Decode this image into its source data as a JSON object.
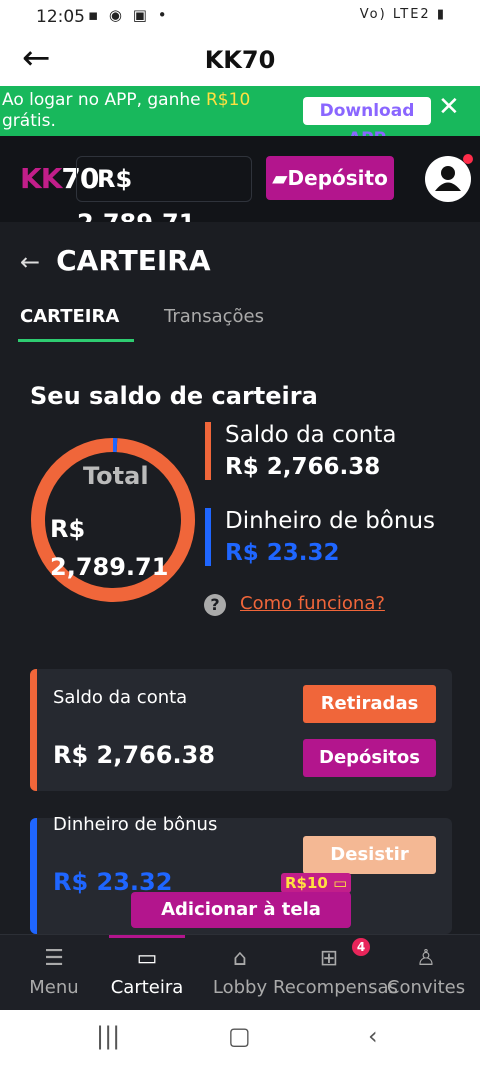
{
  "status_bar": {
    "time": "12:05",
    "left_icons": "▪ ◉ ▣ •",
    "right_icons": "Vo) LTE2 ▮"
  },
  "app_header": {
    "title": "KK70"
  },
  "promo": {
    "text_before": "Ao logar no APP, ganhe ",
    "amount": "R$10",
    "text_after": " grátis.",
    "download_label": "Download APP"
  },
  "site_header": {
    "logo_kk": "KK",
    "logo_num": "70",
    "balance": "R$ 2,789.71",
    "deposit_label": "Depósito"
  },
  "page": {
    "title": "CARTEIRA",
    "tabs": [
      "CARTEIRA",
      "Transações"
    ],
    "section_title": "Seu saldo de carteira"
  },
  "donut": {
    "total_label": "Total",
    "total_value_line1": "R$",
    "total_value_line2": "2,789.71",
    "account_fraction": 0.9916,
    "bonus_fraction": 0.0084
  },
  "legend": [
    {
      "label": "Saldo da conta",
      "value": "R$ 2,766.38",
      "color": "#f0663a"
    },
    {
      "label": "Dinheiro de bônus",
      "value": "R$ 23.32",
      "color": "#1f66ff"
    }
  ],
  "how_link": "Como funciona?",
  "cards": {
    "account": {
      "label": "Saldo da conta",
      "value": "R$ 2,766.38",
      "btn_withdraw": "Retiradas",
      "btn_deposit": "Depósitos"
    },
    "bonus": {
      "label": "Dinheiro de bônus",
      "value": "R$ 23.32",
      "btn_give_up": "Desistir"
    }
  },
  "popup": {
    "add_home": "Adicionar à tela inicial",
    "reward_badge": "R$10"
  },
  "bottom_nav": [
    {
      "label": "Menu",
      "icon": "menu-icon"
    },
    {
      "label": "Carteira",
      "icon": "wallet-icon"
    },
    {
      "label": "Lobby",
      "icon": "home-icon"
    },
    {
      "label": "Recompensas",
      "icon": "gift-icon",
      "badge": "4"
    },
    {
      "label": "Convites",
      "icon": "add-user-icon"
    }
  ]
}
